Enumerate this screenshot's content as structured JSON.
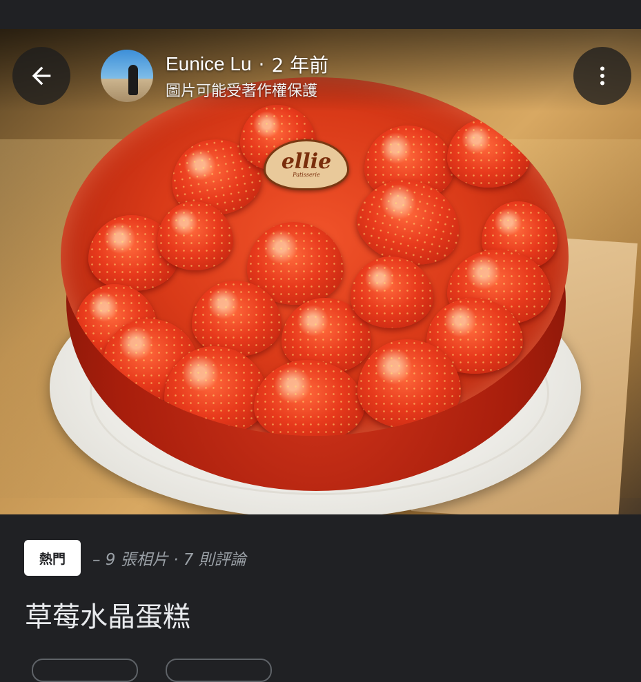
{
  "header": {
    "author_name": "Eunice Lu",
    "separator": "·",
    "time_ago": "2 年前",
    "copyright_notice": "圖片可能受著作權保護",
    "back_icon": "arrow-back-icon",
    "more_icon": "more-vert-icon"
  },
  "photo": {
    "logo_text": "ellie",
    "logo_subtext": "Patisserie"
  },
  "info": {
    "badge": "熱門",
    "meta": "– 9 張相片 · 7 則評論",
    "title": "草莓水晶蛋糕"
  },
  "colors": {
    "background": "#202124",
    "meta_text": "#9aa0a6",
    "title_text": "#e8eaed",
    "badge_bg": "#ffffff"
  }
}
